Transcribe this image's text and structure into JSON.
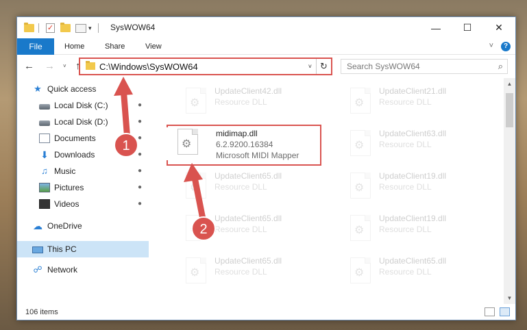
{
  "window": {
    "title": "SysWOW64",
    "minimize": "—",
    "maximize": "☐",
    "close": "✕"
  },
  "ribbon": {
    "tabs": [
      "File",
      "Home",
      "Share",
      "View"
    ],
    "collapse": "˅",
    "help": "?"
  },
  "nav": {
    "back": "←",
    "forward": "→",
    "recent": "˅",
    "up": "↑",
    "address": "C:\\Windows\\SysWOW64",
    "address_drop": "˅",
    "refresh": "↻",
    "search_placeholder": "Search SysWOW64",
    "search_icon": "⌕"
  },
  "sidebar": {
    "items": [
      {
        "label": "Quick access",
        "icon": "star-icon"
      },
      {
        "label": "Local Disk (C:)",
        "icon": "disk-icon",
        "pinned": true
      },
      {
        "label": "Local Disk (D:)",
        "icon": "disk-icon",
        "pinned": true
      },
      {
        "label": "Documents",
        "icon": "document-icon",
        "pinned": true
      },
      {
        "label": "Downloads",
        "icon": "download-icon",
        "pinned": true
      },
      {
        "label": "Music",
        "icon": "music-icon",
        "pinned": true
      },
      {
        "label": "Pictures",
        "icon": "pictures-icon",
        "pinned": true
      },
      {
        "label": "Videos",
        "icon": "video-icon",
        "pinned": true
      },
      {
        "label": "OneDrive",
        "icon": "cloud-icon"
      },
      {
        "label": "This PC",
        "icon": "computer-icon",
        "selected": true
      },
      {
        "label": "Network",
        "icon": "network-icon"
      }
    ],
    "pin_glyph": "📌"
  },
  "files": {
    "highlighted": {
      "name": "midimap.dll",
      "version": "6.2.9200.16384",
      "description": "Microsoft MIDI Mapper"
    },
    "background": [
      {
        "name": "UpdateClient42.dll",
        "type": "Resource DLL"
      },
      {
        "name": "UpdateClient21.dll",
        "type": "Resource DLL"
      },
      {
        "name": "UpdateClient63.dll",
        "type": "Resource DLL"
      },
      {
        "name": "UpdateClient65.dll",
        "type": "Resource DLL"
      },
      {
        "name": "UpdateClient19.dll",
        "type": "Resource DLL"
      },
      {
        "name": "UpdateClient65.dll",
        "type": "Resource DLL"
      },
      {
        "name": "UpdateClient19.dll",
        "type": "Resource DLL"
      },
      {
        "name": "UpdateClient65.dll",
        "type": "Resource DLL"
      },
      {
        "name": "UpdateClient65.dll",
        "type": "Resource DLL"
      }
    ]
  },
  "status": {
    "item_count": "106 items"
  },
  "callouts": [
    "1",
    "2"
  ],
  "colors": {
    "accent": "#1979ca",
    "callout_red": "#d9534f",
    "selected": "#cce4f7"
  }
}
